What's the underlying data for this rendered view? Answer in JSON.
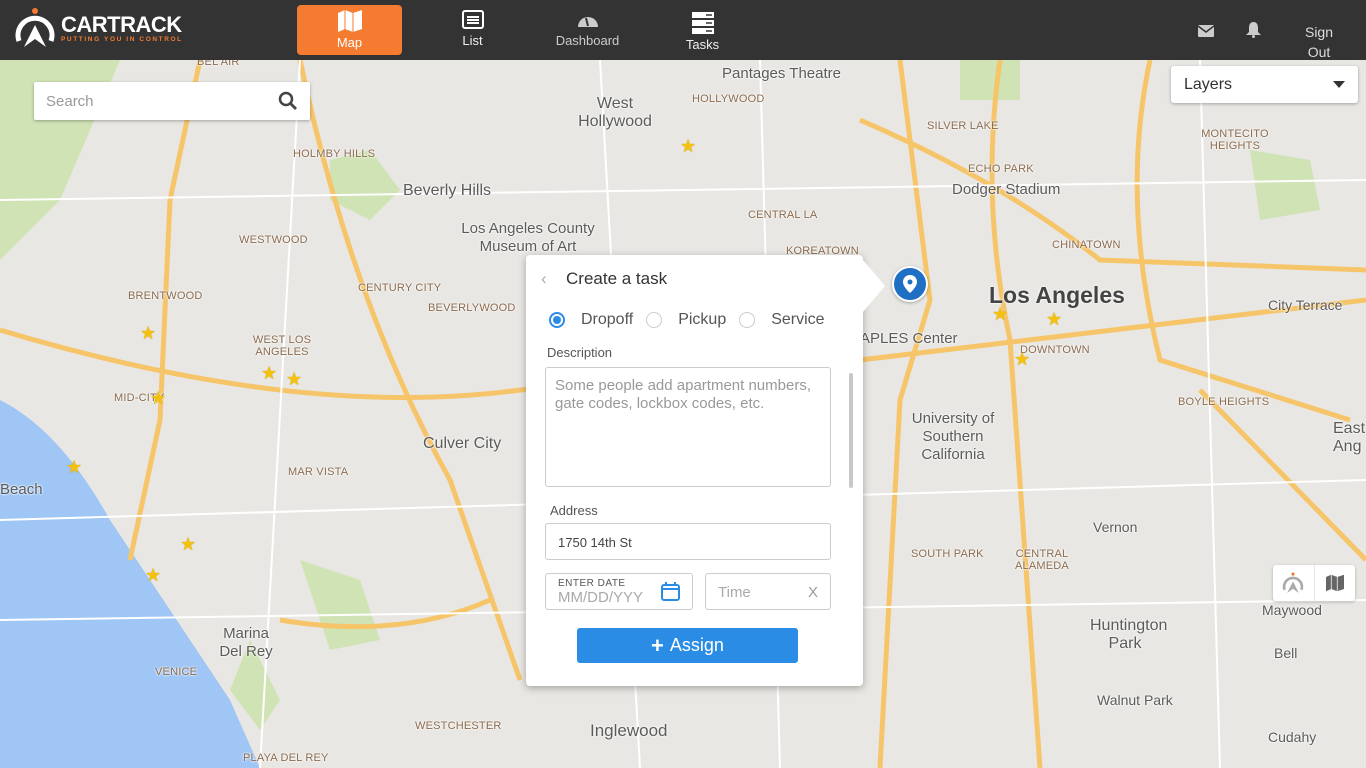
{
  "header": {
    "brand": "CARTRACK",
    "tagline": "PUTTING YOU IN CONTROL",
    "nav": [
      {
        "label": "Map",
        "icon": "map-icon",
        "active": true
      },
      {
        "label": "List",
        "icon": "list-icon"
      },
      {
        "label": "Dashboard",
        "icon": "dashboard-icon"
      },
      {
        "label": "Tasks",
        "icon": "tasks-icon"
      }
    ],
    "sign_out_line1": "Sign",
    "sign_out_line2": "Out",
    "accent": "#f47b30"
  },
  "search": {
    "placeholder": "Search"
  },
  "layers": {
    "label": "Layers"
  },
  "task_panel": {
    "title": "Create a task",
    "types": [
      "Dropoff",
      "Pickup",
      "Service"
    ],
    "selected_type": "Dropoff",
    "description_label": "Description",
    "description_placeholder": "Some people add apartment numbers, gate codes, lockbox codes, etc.",
    "address_label": "Address",
    "address_value": "1750 14th St",
    "date_label": "ENTER DATE",
    "date_placeholder": "MM/DD/YYY",
    "time_placeholder": "Time",
    "time_clear": "X",
    "assign_label": "Assign",
    "button_color": "#2b8ce6"
  },
  "map_labels": [
    "Pantages Theatre",
    "West Hollywood",
    "HOLLYWOOD",
    "Beverly Hills",
    "Los Angeles County Museum of Art",
    "HOLMBY HILLS",
    "WESTWOOD",
    "BRENTWOOD",
    "CENTURY CITY",
    "BEVERLYWOOD",
    "WEST LOS ANGELES",
    "MID-CITY",
    "Culver City",
    "MAR VISTA",
    "Beach",
    "VENICE",
    "Marina Del Rey",
    "WESTCHESTER",
    "Inglewood",
    "PLAYA DEL REY",
    "Los Angeles",
    "Dodger Stadium",
    "SILVER LAKE",
    "ECHO PARK",
    "CHINATOWN",
    "City Terrace",
    "DOWNTOWN",
    "BOYLE HEIGHTS",
    "University of Southern California",
    "Vernon",
    "SOUTH PARK",
    "CENTRAL ALAMEDA",
    "Huntington Park",
    "Bell",
    "Maywood",
    "Walnut Park",
    "Cudahy",
    "MONTECITO HEIGHTS",
    "CENTRAL LA",
    "KOREATOWN",
    "BEL AIR",
    "APLES Center",
    "East Ang"
  ]
}
